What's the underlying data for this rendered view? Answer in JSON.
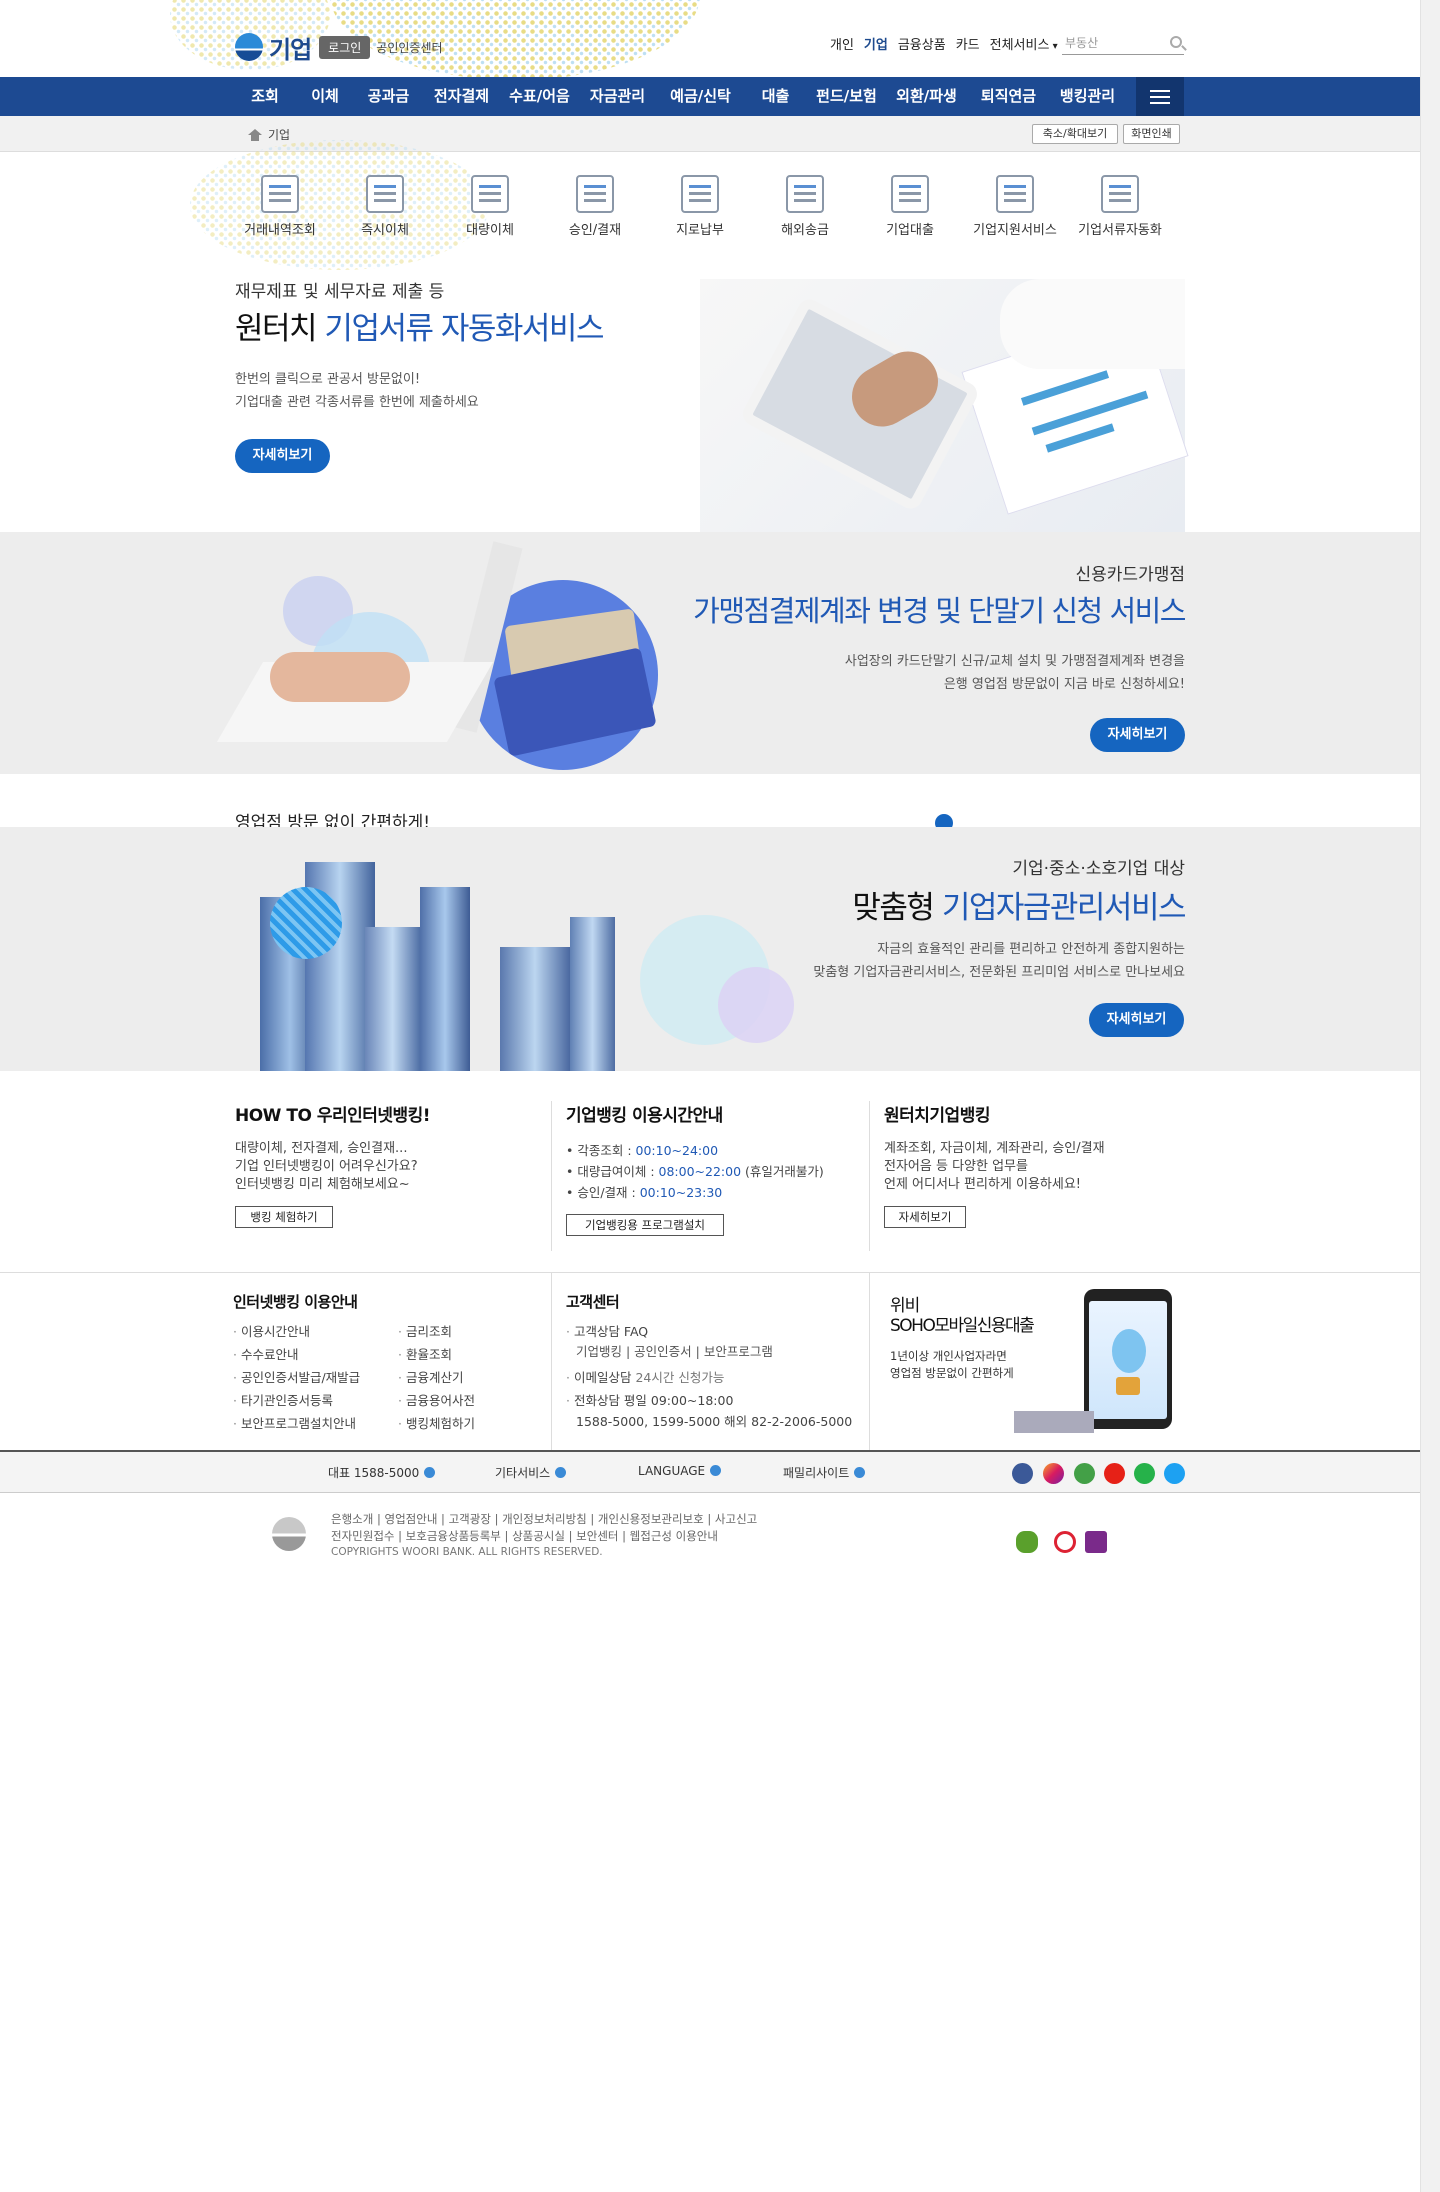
{
  "header": {
    "logo_title": "기업",
    "login_label": "로그인",
    "cert_center": "공인인증센터",
    "top_nav": [
      "개인",
      "기업",
      "금융상품",
      "카드",
      "전체서비스"
    ],
    "search_placeholder": "부동산"
  },
  "gnb": [
    "조회",
    "이체",
    "공과금",
    "전자결제",
    "수표/어음",
    "자금관리",
    "예금/신탁",
    "대출",
    "펀드/보험",
    "외환/파생",
    "퇴직연금",
    "뱅킹관리"
  ],
  "breadcrumb": {
    "current": "기업"
  },
  "util_buttons": {
    "zoom": "축소/확대보기",
    "print": "화면인쇄"
  },
  "quick_menu": [
    "거래내역조회",
    "즉시이체",
    "대량이체",
    "승인/결재",
    "지로납부",
    "해외송금",
    "기업대출",
    "기업지원서비스",
    "기업서류자동화"
  ],
  "banner1": {
    "subtitle": "재무제표 및 세무자료 제출 등",
    "title_plain": "원터치",
    "title_accent": "기업서류 자동화서비스",
    "desc1": "한번의 클릭으로 관공서 방문없이!",
    "desc2": "기업대출 관련 각종서류를 한번에 제출하세요",
    "button": "자세히보기"
  },
  "banner2": {
    "subtitle": "신용카드가맹점",
    "title": "가맹점결제계좌 변경 및 단말기 신청 서비스",
    "desc1": "사업장의 카드단말기 신규/교체 설치 및  가맹점결제계좌 변경을",
    "desc2": "은행 영업점 방문없이 지금 바로 신청하세요!",
    "button": "자세히보기"
  },
  "strip_text": "영업점 방문 없이 간편하게!",
  "banner3": {
    "subtitle": "기업·중소·소호기업 대상",
    "title_plain": "맞춤형",
    "title_accent": "기업자금관리서비스",
    "desc1": "자금의 효율적인 관리를 편리하고 안전하게 종합지원하는",
    "desc2": "맞춤형 기업자금관리서비스, 전문화된 프리미엄 서비스로 만나보세요",
    "button": "자세히보기"
  },
  "info": {
    "howto": {
      "title": "HOW TO 우리인터넷뱅킹!",
      "lines": [
        "대량이체, 전자결제, 승인결재...",
        "기업 인터넷뱅킹이 어려우신가요?",
        "인터넷뱅킹 미리 체험해보세요~"
      ],
      "button": "뱅킹 체험하기"
    },
    "hours": {
      "title": "기업뱅킹 이용시간안내",
      "rows": [
        {
          "label": "• 각종조회 : ",
          "time": "00:10~24:00",
          "note": ""
        },
        {
          "label": "• 대량급여이체 : ",
          "time": "08:00~22:00",
          "note": " (휴일거래불가)"
        },
        {
          "label": "• 승인/결재 : ",
          "time": "00:10~23:30",
          "note": ""
        }
      ],
      "button": "기업뱅킹용 프로그램설치"
    },
    "onetouch": {
      "title": "원터치기업뱅킹",
      "lines": [
        "계좌조회, 자금이체, 계좌관리, 승인/결재",
        "전자어음 등 다양한 업무를",
        "언제 어디서나 편리하게 이용하세요!"
      ],
      "button": "자세히보기"
    }
  },
  "guide": {
    "title": "인터넷뱅킹 이용안내",
    "col1": [
      "이용시간안내",
      "수수료안내",
      "공인인증서발급/재발급",
      "타기관인증서등록",
      "보안프로그램설치안내"
    ],
    "col2": [
      "금리조회",
      "환율조회",
      "금융계산기",
      "금융용어사전",
      "뱅킹체험하기"
    ]
  },
  "customer": {
    "title": "고객센터",
    "faq": "고객상담 FAQ",
    "faq_links": "기업뱅킹 | 공인인증서 | 보안프로그램",
    "email_label": "이메일상담 ",
    "email_note": "24시간 신청가능",
    "phone": "전화상담 평일 09:00~18:00",
    "numbers": "1588-5000, 1599-5000 해외 82-2-2006-5000"
  },
  "promo": {
    "title1": "위비",
    "title2": "SOHO모바일신용대출",
    "desc1": "1년이상 개인사업자라면",
    "desc2": "영업점 방문없이 간편하게"
  },
  "footer_bar": [
    "대표 1588-5000",
    "기타서비스",
    "LANGUAGE",
    "패밀리사이트"
  ],
  "footer": {
    "links1": "은행소개 | 영업점안내 | 고객광장 | 개인정보처리방침 | 개인신용정보관리보호 | 사고신고",
    "links2": "전자민원접수 | 보호금융상품등록부 | 상품공시실 | 보안센터 | 웹접근성 이용안내",
    "copyright": "COPYRIGHTS WOORI BANK. ALL RIGHTS RESERVED."
  },
  "colors": {
    "brand_blue": "#1d4a92",
    "accent_blue": "#2059b5",
    "button_blue": "#1565c0"
  }
}
